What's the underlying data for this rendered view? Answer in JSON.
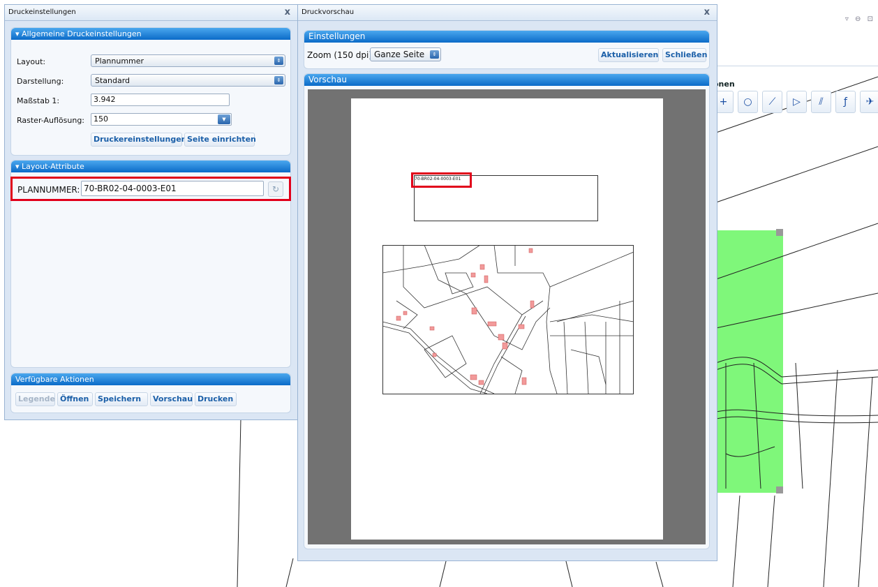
{
  "left_window": {
    "title": "Druckeinstellungen",
    "close_label": "x",
    "general": {
      "header": "▾ Allgemeine Druckeinstellungen",
      "layout_label": "Layout:",
      "layout_value": "Plannummer",
      "display_label": "Darstellung:",
      "display_value": "Standard",
      "scale_label": "Maßstab 1:",
      "scale_value": "3.942",
      "raster_label": "Raster-Auflösung:",
      "raster_value": "150",
      "printer_settings_button": "Druckereinstellungen",
      "page_setup_button": "Seite einrichten"
    },
    "layout_attributes": {
      "header": "▾ Layout-Attribute",
      "field_label": "PLANNUMMER:",
      "field_value": "70-BR02-04-0003-E01"
    },
    "actions": {
      "header": "Verfügbare Aktionen",
      "buttons": [
        "Legende",
        "Öffnen",
        "Speichern",
        "Vorschau",
        "Drucken"
      ]
    }
  },
  "preview_window": {
    "title": "Druckvorschau",
    "close_label": "x",
    "settings": {
      "header": "Einstellungen",
      "zoom_label": "Zoom (150 dpi):",
      "zoom_value": "Ganze Seite",
      "refresh_button": "Aktualisieren",
      "close_button": "Schließen"
    },
    "preview": {
      "header": "Vorschau",
      "plan_number_text": "70-BR02-04-0003-E01"
    }
  },
  "map": {
    "toolbar_label": "onen",
    "window_controls": "▿ ⊖ ⊡"
  },
  "colors": {
    "header_blue": "#0b6bc8",
    "highlight_red": "#e1001a",
    "selection_green": "#7ff77a",
    "link_blue": "#1b5fa8"
  }
}
